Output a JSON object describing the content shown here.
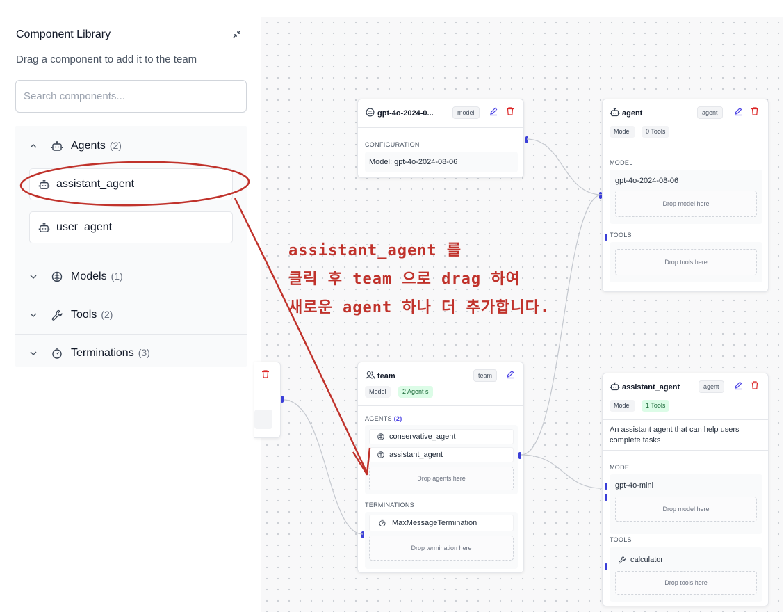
{
  "sidebar": {
    "title": "Component Library",
    "description": "Drag a component to add it to the team",
    "search_placeholder": "Search components...",
    "groups": [
      {
        "label": "Agents",
        "count": "(2)",
        "expanded": true,
        "icon": "bot-icon",
        "items": [
          {
            "label": "assistant_agent",
            "icon": "bot-icon"
          },
          {
            "label": "user_agent",
            "icon": "bot-icon"
          }
        ]
      },
      {
        "label": "Models",
        "count": "(1)",
        "expanded": false,
        "icon": "brain-icon"
      },
      {
        "label": "Tools",
        "count": "(2)",
        "expanded": false,
        "icon": "wrench-icon"
      },
      {
        "label": "Terminations",
        "count": "(3)",
        "expanded": false,
        "icon": "timer-icon"
      }
    ]
  },
  "canvas": {
    "model_node": {
      "title": "gpt-4o-2024-0...",
      "badge": "model",
      "section": "CONFIGURATION",
      "config": "Model: gpt-4o-2024-08-06"
    },
    "agent_node": {
      "title": "agent",
      "badge": "agent",
      "pill_model": "Model",
      "pill_tools": "0 Tools",
      "model_label": "MODEL",
      "model_value": "gpt-4o-2024-08-06",
      "drop_model": "Drop model here",
      "tools_label": "TOOLS",
      "drop_tools": "Drop tools here"
    },
    "team_node": {
      "title": "team",
      "badge": "team",
      "pill_model": "Model",
      "pill_agents": "2 Agent s",
      "agents_label": "AGENTS",
      "agents_count": "(2)",
      "agents": [
        "conservative_agent",
        "assistant_agent"
      ],
      "drop_agents": "Drop agents here",
      "terminations_label": "TERMINATIONS",
      "termination": "MaxMessageTermination",
      "drop_termination": "Drop termination here"
    },
    "assistant_node": {
      "title": "assistant_agent",
      "badge": "agent",
      "pill_model": "Model",
      "pill_tools": "1 Tools",
      "description": "An assistant agent that can help users complete tasks",
      "model_label": "MODEL",
      "model_value": "gpt-4o-mini",
      "drop_model": "Drop model here",
      "tools_label": "TOOLS",
      "tool": "calculator",
      "drop_tools": "Drop tools here"
    }
  },
  "annotation": {
    "line1": "assistant_agent 를",
    "line2": "클릭 후 team 으로 drag 하여",
    "line3": "새로운 agent 하나 더 추가합니다.",
    "color": "#c0322b"
  }
}
